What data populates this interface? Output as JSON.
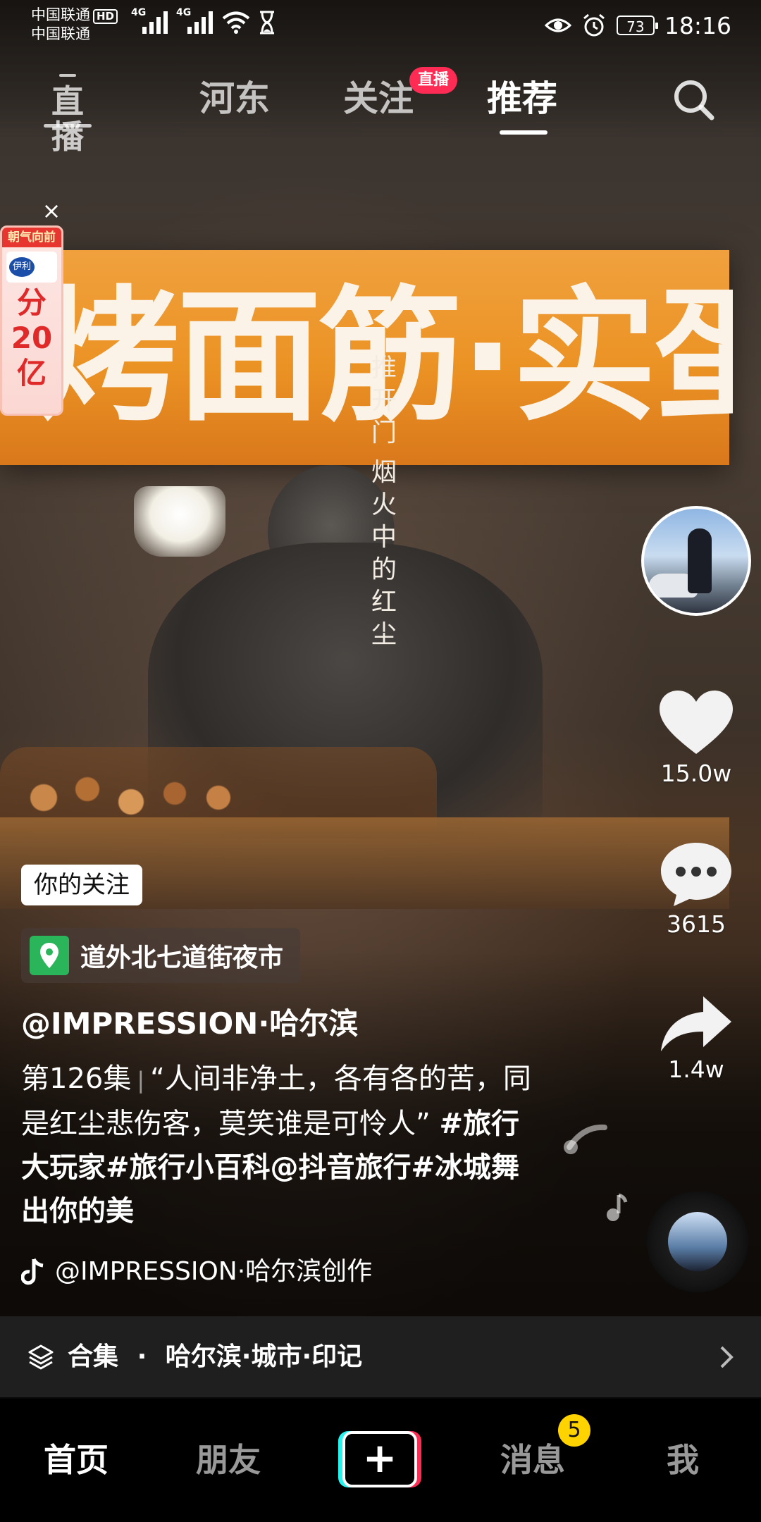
{
  "status_bar": {
    "carrier_1": "中国联通",
    "hd": "HD",
    "carrier_2": "中国联通",
    "net_1": "4G",
    "net_2": "4G",
    "battery": "73",
    "time": "18:16"
  },
  "top_nav": {
    "live_label": "直播",
    "tabs": [
      "河东",
      "关注",
      "推荐"
    ],
    "active_tab": "推荐",
    "follow_live_badge": "直播"
  },
  "video": {
    "sign_text": "烤面筋·实蛋",
    "overlay_vertical_1": [
      "推",
      "开",
      "门"
    ],
    "overlay_vertical_2": [
      "烟",
      "火",
      "中",
      "的",
      "红",
      "尘"
    ]
  },
  "ad": {
    "banner": "朝气向前",
    "brand": "伊利",
    "promo_line1": "分",
    "promo_line2": "20",
    "promo_line3": "亿"
  },
  "side_rail": {
    "likes": "15.0w",
    "comments": "3615",
    "shares": "1.4w"
  },
  "info": {
    "follow_tag": "你的关注",
    "location": "道外北七道街夜市",
    "author": "@IMPRESSION·哈尔滨",
    "episode": "第126集",
    "caption_text": "“人间非净土，各有各的苦，同是红尘悲伤客，莫笑谁是可怜人”",
    "hashtags": "#旅行大玩家#旅行小百科@抖音旅行#冰城舞出你的美",
    "music": "@IMPRESSION·哈尔滨创作"
  },
  "collection": {
    "label": "合集",
    "dot": "·",
    "title": "哈尔滨·城市·印记"
  },
  "bottom_nav": {
    "home": "首页",
    "friends": "朋友",
    "plus": "+",
    "messages": "消息",
    "messages_badge": "5",
    "me": "我"
  },
  "colors": {
    "accent_red": "#fe2c55",
    "accent_cyan": "#25f4ee",
    "badge_yellow": "#ffd300",
    "location_green": "#2bb55a"
  }
}
